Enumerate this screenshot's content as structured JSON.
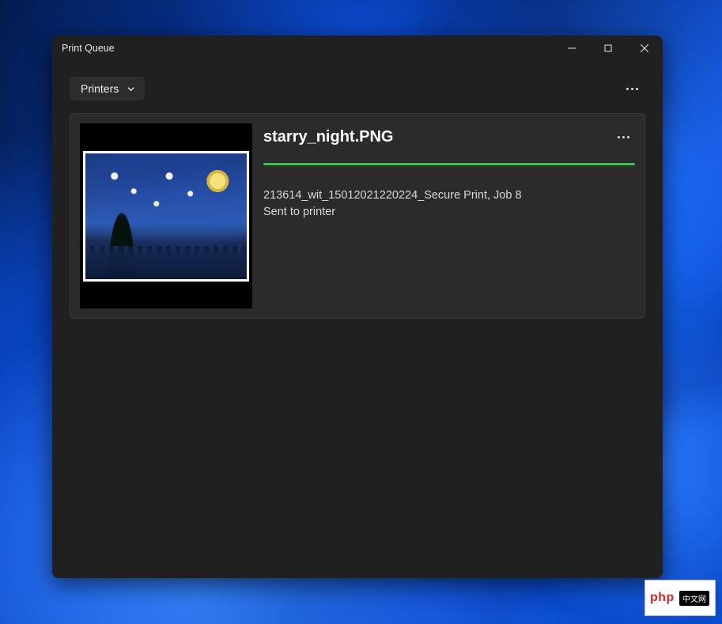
{
  "window": {
    "title": "Print Queue"
  },
  "toolbar": {
    "dropdown_label": "Printers"
  },
  "job": {
    "filename": "starry_night.PNG",
    "detail_line": "213614_wit_15012021220224_Secure Print, Job 8",
    "status": "Sent to printer",
    "progress_color": "#37c440"
  },
  "watermark": {
    "logo": "php",
    "tag": "中文网"
  }
}
